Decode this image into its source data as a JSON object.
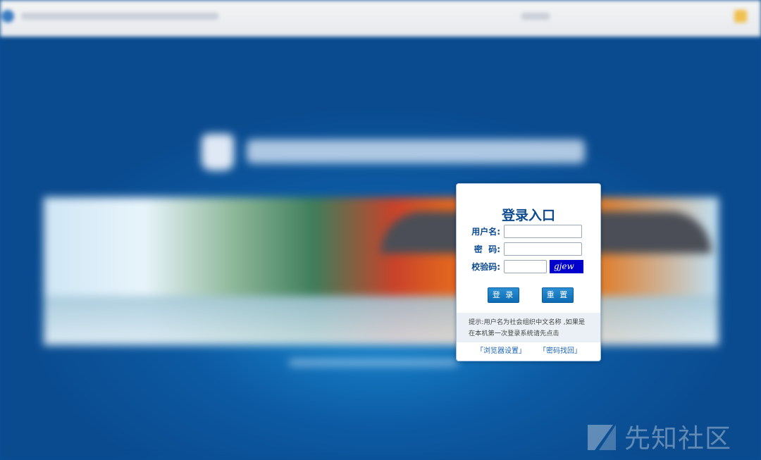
{
  "login": {
    "title": "登录入口",
    "username_label": "用户名:",
    "password_label": "密  码:",
    "captcha_label": "校验码:",
    "captcha_text": "gjew",
    "login_button": "登 录",
    "reset_button": "重 置",
    "tip_text": "提示:用户名为社会组织中文名称 ,如果是在本机第一次登录系统请先点击",
    "browser_settings_link": "「浏览器设置」",
    "password_recovery_link": "「密码找回」"
  },
  "watermark": {
    "text": "先知社区"
  },
  "colors": {
    "page_background": "#0a4f95",
    "title_blue": "#0d4b90",
    "button_blue": "#1a7cc4",
    "captcha_bg": "#0000cc"
  }
}
